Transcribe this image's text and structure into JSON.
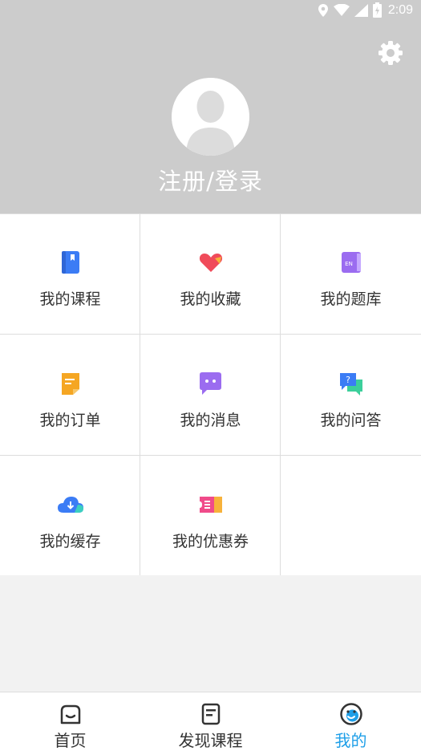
{
  "status_bar": {
    "time": "2:09"
  },
  "header": {
    "login_text": "注册/登录"
  },
  "menu": {
    "items": [
      {
        "label": "我的课程",
        "icon": "course-book-icon",
        "color": "#3b7cf5"
      },
      {
        "label": "我的收藏",
        "icon": "favorite-heart-icon",
        "color": "#f04b5a"
      },
      {
        "label": "我的题库",
        "icon": "question-bank-icon",
        "color": "#9b6cf0"
      },
      {
        "label": "我的订单",
        "icon": "order-note-icon",
        "color": "#f5a623"
      },
      {
        "label": "我的消息",
        "icon": "message-bubble-icon",
        "color": "#9b6cf0"
      },
      {
        "label": "我的问答",
        "icon": "qa-bubble-icon",
        "color": "#3b7cf5"
      },
      {
        "label": "我的缓存",
        "icon": "download-cloud-icon",
        "color": "#3b7cf5"
      },
      {
        "label": "我的优惠券",
        "icon": "coupon-ticket-icon",
        "color": "#f04b8a"
      }
    ]
  },
  "tabbar": {
    "tabs": [
      {
        "label": "首页",
        "icon": "home-icon"
      },
      {
        "label": "发现课程",
        "icon": "discover-courses-icon"
      },
      {
        "label": "我的",
        "icon": "profile-face-icon",
        "active": true
      }
    ],
    "active_color": "#1e9fe8"
  }
}
